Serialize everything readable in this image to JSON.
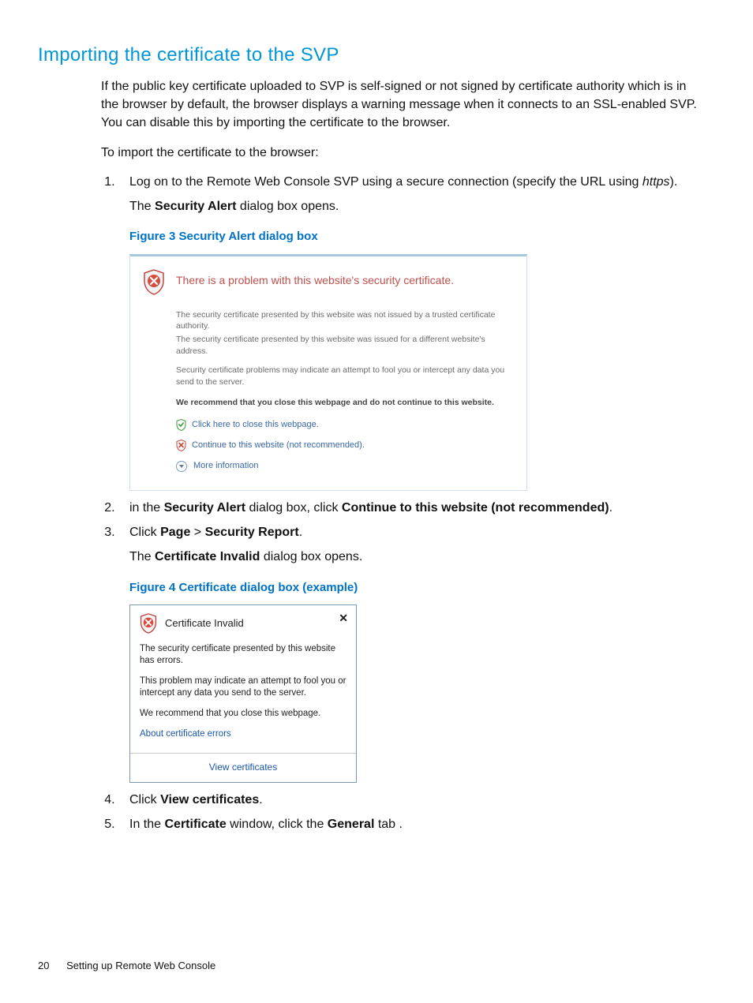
{
  "heading": "Importing the certificate to the SVP",
  "intro": "If the public key certificate uploaded to SVP is self-signed or not signed by certificate authority which is in the browser by default, the browser displays a warning message when it connects to an SSL-enabled SVP. You can disable this by importing the certificate to the browser.",
  "lead_in": "To import the certificate to the browser:",
  "steps": {
    "s1_a": "Log on to the Remote Web Console SVP using a secure connection (specify the URL using ",
    "s1_italic": "https",
    "s1_b": ").",
    "s1_sub_a": "The ",
    "s1_sub_bold": "Security Alert",
    "s1_sub_b": " dialog box opens.",
    "s2_a": "in the ",
    "s2_b1": "Security Alert",
    "s2_c": " dialog box, click ",
    "s2_b2": "Continue to this website (not recommended)",
    "s2_d": ".",
    "s3_a": "Click ",
    "s3_b1": "Page",
    "s3_gt": " > ",
    "s3_b2": "Security Report",
    "s3_c": ".",
    "s3_sub_a": "The ",
    "s3_sub_bold": "Certificate Invalid",
    "s3_sub_b": " dialog box opens.",
    "s4_a": "Click ",
    "s4_b": "View certificates",
    "s4_c": ".",
    "s5_a": "In the ",
    "s5_b1": "Certificate",
    "s5_c": " window, click the ",
    "s5_b2": "General",
    "s5_d": " tab ."
  },
  "fig3": {
    "caption": "Figure 3 Security Alert dialog box",
    "title": "There is a problem with this website's security certificate.",
    "line1": "The security certificate presented by this website was not issued by a trusted certificate authority.",
    "line2": "The security certificate presented by this website was issued for a different website's address.",
    "para2": "Security certificate problems may indicate an attempt to fool you or intercept any data you send to the server.",
    "recommend": "We recommend that you close this webpage and do not continue to this website.",
    "link_close": "Click here to close this webpage.",
    "link_continue": "Continue to this website (not recommended).",
    "more_info": "More information"
  },
  "fig4": {
    "caption": "Figure 4 Certificate dialog box (example)",
    "close": "✕",
    "title": "Certificate Invalid",
    "p1": "The security certificate presented by this website has errors.",
    "p2": "This problem may indicate an attempt to fool you or intercept any data you send to the server.",
    "p3": "We recommend that you close this webpage.",
    "about_link": "About certificate errors",
    "view_btn": "View certificates"
  },
  "footer": {
    "page_num": "20",
    "section": "Setting up Remote Web Console"
  }
}
